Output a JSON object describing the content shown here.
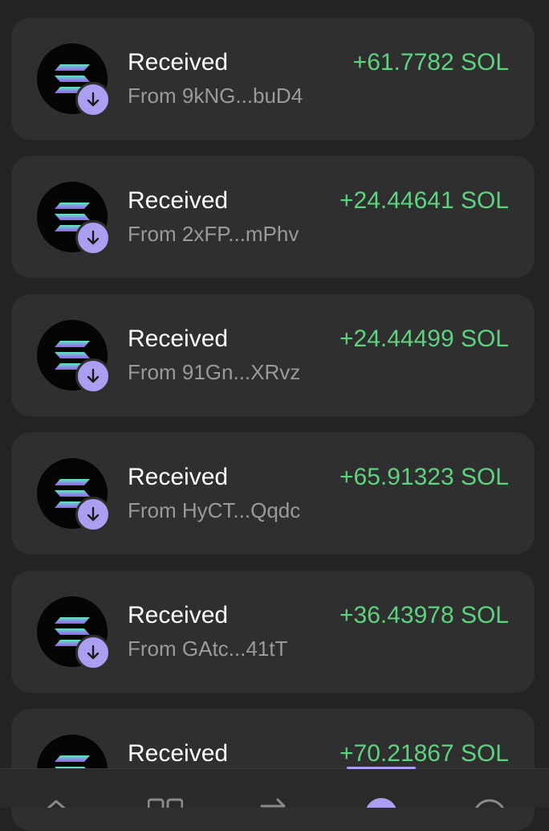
{
  "transactions": [
    {
      "title": "Received",
      "from": "From 9kNG...buD4",
      "amount": "+61.7782 SOL"
    },
    {
      "title": "Received",
      "from": "From 2xFP...mPhv",
      "amount": "+24.44641 SOL"
    },
    {
      "title": "Received",
      "from": "From 91Gn...XRvz",
      "amount": "+24.44499 SOL"
    },
    {
      "title": "Received",
      "from": "From HyCT...Qqdc",
      "amount": "+65.91323 SOL"
    },
    {
      "title": "Received",
      "from": "From GAtc...41tT",
      "amount": "+36.43978 SOL"
    },
    {
      "title": "Received",
      "from": "",
      "amount": "+70.21867 SOL"
    }
  ],
  "colors": {
    "background": "#232323",
    "card": "#2f2f2f",
    "accent": "#ab9ff2",
    "positive": "#5bd37f",
    "muted_text": "#9a9a9a"
  },
  "icons": {
    "token": "solana-icon",
    "badge": "arrow-down-icon",
    "nav": [
      "home-icon",
      "grid-icon",
      "swap-icon",
      "activity-icon",
      "search-icon"
    ]
  }
}
